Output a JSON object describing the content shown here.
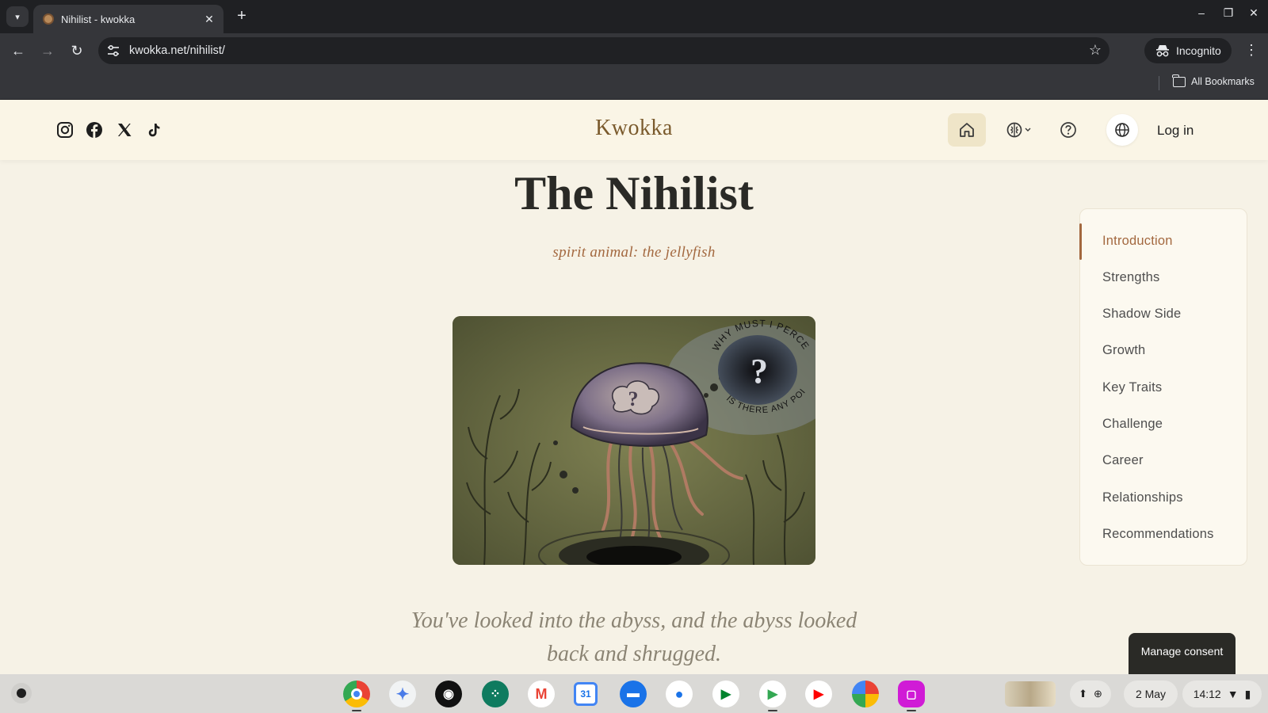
{
  "browser": {
    "tab_title": "Nihilist - kwokka",
    "url": "kwokka.net/nihilist/",
    "incognito_label": "Incognito",
    "all_bookmarks_label": "All Bookmarks"
  },
  "site": {
    "brand": "Kwokka",
    "login_label": "Log in",
    "socials": [
      "instagram-icon",
      "facebook-icon",
      "x-icon",
      "tiktok-icon"
    ]
  },
  "page": {
    "title": "The Nihilist",
    "subtitle": "spirit animal: the jellyfish",
    "quote_line1": "You've looked into the abyss, and the abyss looked",
    "quote_line2": "back and shrugged.",
    "image_text_top": "WHY MUST I PERCEIVE?",
    "image_text_bottom": "IS THERE ANY POINT?"
  },
  "toc": {
    "active_index": 0,
    "items": [
      "Introduction",
      "Strengths",
      "Shadow Side",
      "Growth",
      "Key Traits",
      "Challenge",
      "Career",
      "Relationships",
      "Recommendations"
    ]
  },
  "consent": {
    "label": "Manage consent"
  },
  "shelf": {
    "date": "2 May",
    "time": "14:12",
    "apps": [
      "chrome",
      "gemini",
      "podcast",
      "app-grid",
      "gmail",
      "calendar",
      "files",
      "messages",
      "meet",
      "play-store",
      "youtube",
      "photos",
      "screen-capture"
    ],
    "calendar_day": "31"
  },
  "colors": {
    "accent": "#a3683f",
    "brand": "#7a5a2c",
    "background": "#f6f2e6"
  }
}
